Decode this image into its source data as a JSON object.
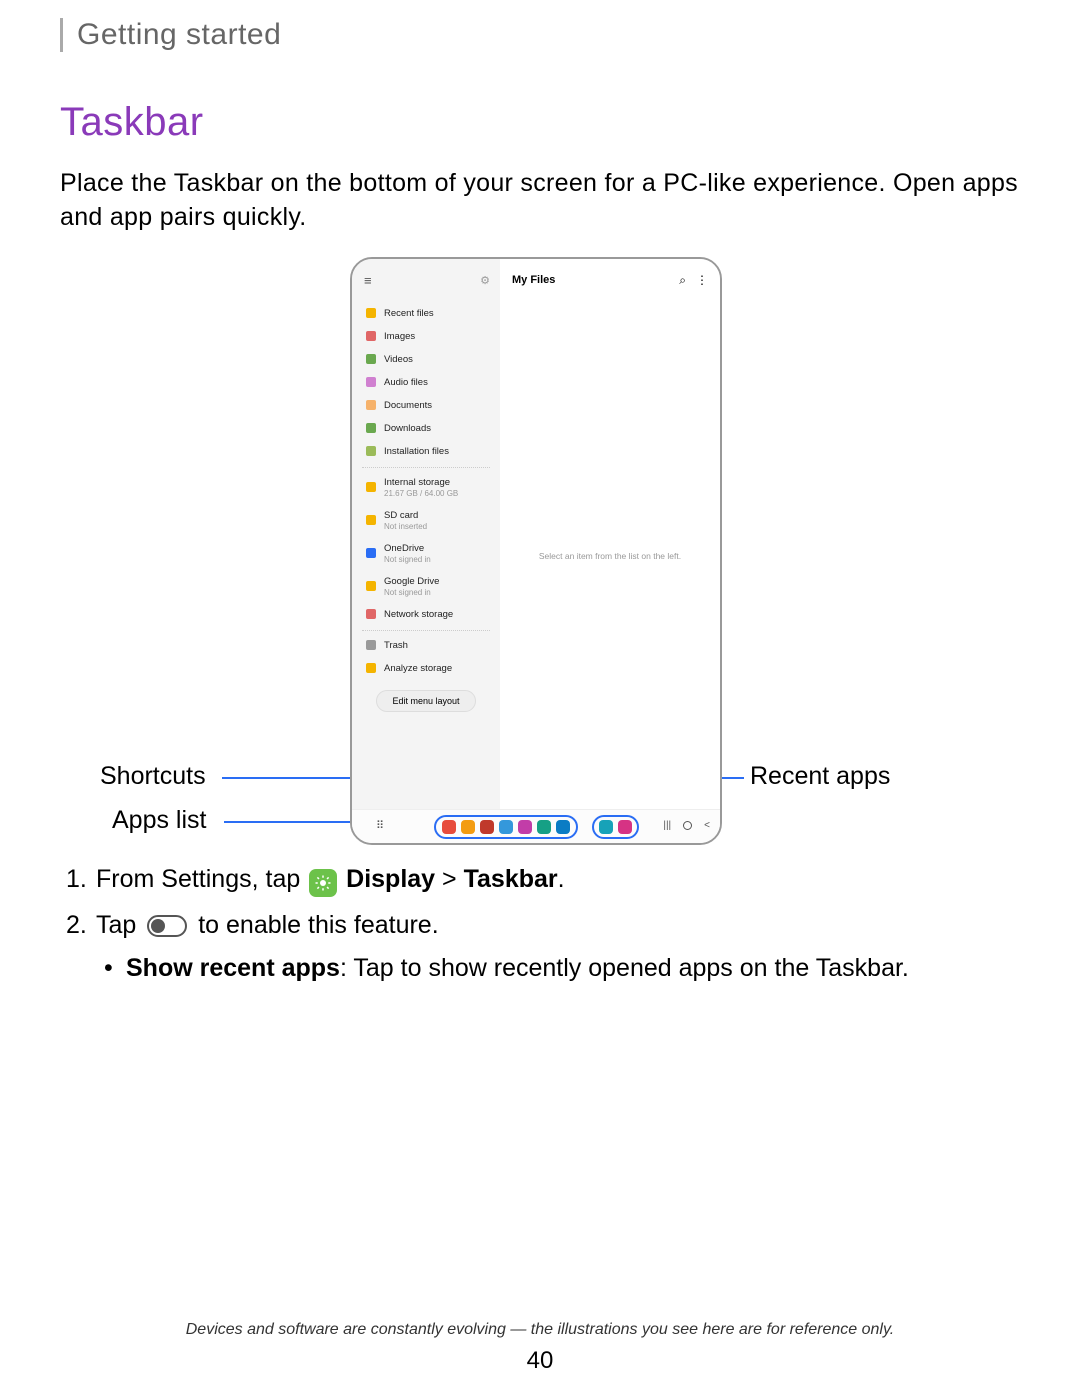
{
  "header": {
    "breadcrumb": "Getting started"
  },
  "title": "Taskbar",
  "intro": "Place the Taskbar on the bottom of your screen for a PC-like experience. Open apps and app pairs quickly.",
  "callouts": {
    "shortcuts": "Shortcuts",
    "apps_list": "Apps list",
    "recent_apps": "Recent apps"
  },
  "device": {
    "main_title": "My Files",
    "empty_hint": "Select an item from the list on the left.",
    "sidebar": {
      "items_a": [
        {
          "label": "Recent files",
          "color": "#f4b400"
        },
        {
          "label": "Images",
          "color": "#e06666"
        },
        {
          "label": "Videos",
          "color": "#6aa84f"
        },
        {
          "label": "Audio files",
          "color": "#d080d0"
        },
        {
          "label": "Documents",
          "color": "#f6b26b"
        },
        {
          "label": "Downloads",
          "color": "#6aa84f"
        },
        {
          "label": "Installation files",
          "color": "#9bbb59"
        }
      ],
      "items_b": [
        {
          "label": "Internal storage",
          "sub": "21.67 GB / 64.00 GB",
          "color": "#f4b400"
        },
        {
          "label": "SD card",
          "sub": "Not inserted",
          "color": "#f4b400"
        },
        {
          "label": "OneDrive",
          "sub": "Not signed in",
          "color": "#2a6df4"
        },
        {
          "label": "Google Drive",
          "sub": "Not signed in",
          "color": "#f4b400"
        },
        {
          "label": "Network storage",
          "color": "#e06666"
        }
      ],
      "items_c": [
        {
          "label": "Trash",
          "color": "#999"
        },
        {
          "label": "Analyze storage",
          "color": "#f4b400"
        }
      ],
      "edit_button": "Edit menu layout"
    },
    "taskbar_colors": {
      "shortcuts": [
        "#e74c3c",
        "#f39c12",
        "#c0392b",
        "#3498db",
        "#c23da8",
        "#16a085",
        "#0a7cc4"
      ],
      "recent": [
        "#17a2b8",
        "#d63384"
      ]
    }
  },
  "steps": {
    "s1_prefix": "From Settings, tap ",
    "s1_bold1": "Display",
    "s1_sep": " > ",
    "s1_bold2": "Taskbar",
    "s1_suffix": ".",
    "s2_prefix": "Tap ",
    "s2_suffix": " to enable this feature.",
    "bullet_bold": "Show recent apps",
    "bullet_rest": ": Tap to show recently opened apps on the Taskbar."
  },
  "footer": "Devices and software are constantly evolving — the illustrations you see here are for reference only.",
  "page_number": "40"
}
